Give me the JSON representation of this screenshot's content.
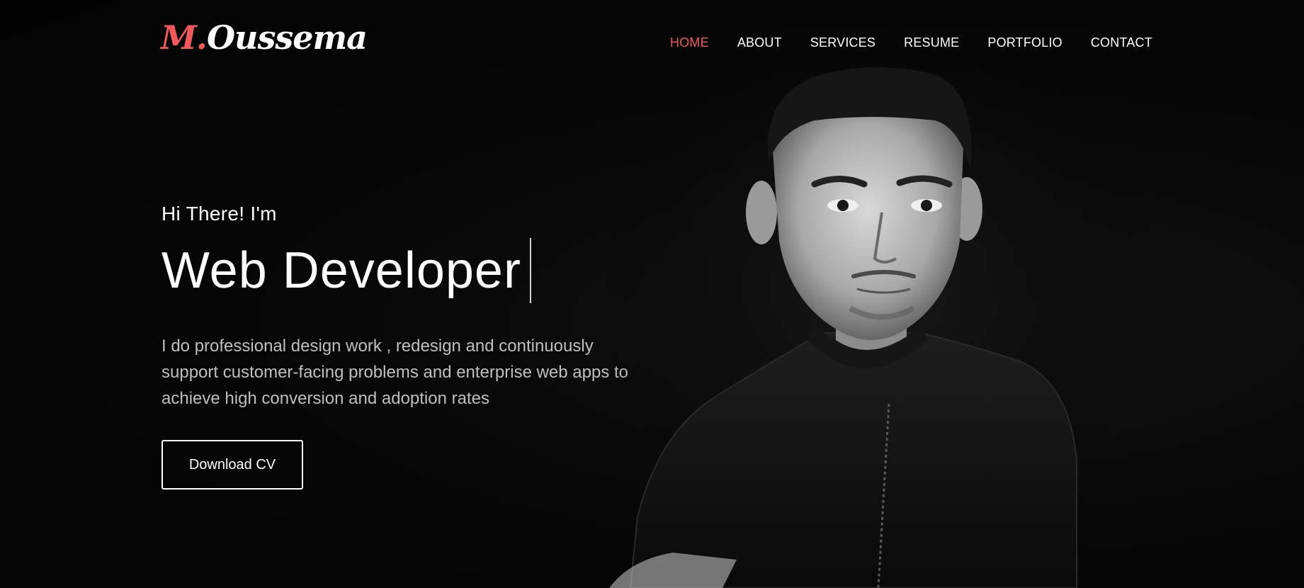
{
  "brand": {
    "logo_initial": "M.",
    "logo_name": "Oussema",
    "accent_color": "#f0585b"
  },
  "nav": {
    "items": [
      {
        "label": "HOME",
        "active": true
      },
      {
        "label": "ABOUT",
        "active": false
      },
      {
        "label": "SERVICES",
        "active": false
      },
      {
        "label": "RESUME",
        "active": false
      },
      {
        "label": "PORTFOLIO",
        "active": false
      },
      {
        "label": "CONTACT",
        "active": false
      }
    ]
  },
  "hero": {
    "greeting": "Hi There! I'm",
    "title": "Web Developer",
    "description": "I do professional design work , redesign and continuously support customer-facing problems and enterprise web apps to achieve high conversion and adoption rates",
    "cta_label": "Download CV"
  },
  "portrait": {
    "icon": "person-photo",
    "style": "black-and-white"
  }
}
